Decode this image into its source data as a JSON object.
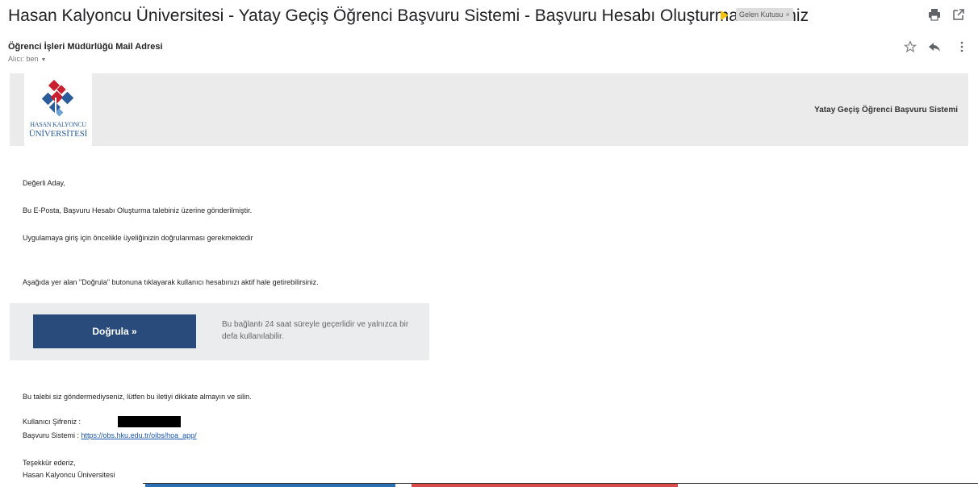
{
  "header": {
    "subject": "Hasan Kalyoncu Üniversitesi - Yatay Geçiş Öğrenci Başvuru Sistemi - Başvuru Hesabı Oluşturma Talebiniz",
    "label": "Gelen Kutusu",
    "label_close": "×",
    "icons": [
      "print-icon",
      "open-in-new-window-icon"
    ]
  },
  "message": {
    "sender": "Öğrenci İşleri Müdürlüğü Mail Adresi",
    "recipient": "Alıcı: ben",
    "recipient_caret": "▼",
    "icons": [
      "star-icon",
      "reply-icon",
      "more-options-icon"
    ]
  },
  "banner": {
    "logo_line1": "HASAN KALYONCU",
    "logo_line2": "ÜNİVERSİTESİ",
    "title": "Yatay Geçiş Öğrenci Başvuru Sistemi",
    "colors": {
      "logo_blue": "#2a5c9a",
      "logo_red": "#c8202f"
    }
  },
  "body": {
    "greeting": "Değerli Aday,",
    "line1": "Bu E-Posta, Başvuru Hesabı Oluşturma talebiniz üzerine gönderilmiştir.",
    "line2": "Uygulamaya giriş için öncelikle üyeliğinizin doğrulanması gerekmektedir",
    "line3": "Aşağıda yer alan \"Doğrula\" butonuna tıklayarak kullanıcı hesabınızı aktif hale getirebilirsiniz.",
    "verify_button": "Doğrula »",
    "verify_note": "Bu bağlantı 24 saat süreyle geçerlidir ve yalnızca bir defa kullanılabilir.",
    "ignore_note": "Bu talebi siz göndermediyseniz, lütfen bu iletiyi dikkate almayın ve silin.",
    "password_label": "Kullanıcı Şifreniz :",
    "system_label": "Başvuru Sistemi : ",
    "system_link": "https://obs.hku.edu.tr/oibs/hoa_app/",
    "thanks": "Teşekkür ederiz,",
    "signature": "Hasan Kalyoncu Üniversitesi"
  },
  "colors": {
    "button_bg": "#284b7c",
    "banner_bg": "#ebebeb",
    "verify_box_bg": "#eaeced",
    "link": "#1a55b0",
    "important_marker": "#f4c20d"
  }
}
